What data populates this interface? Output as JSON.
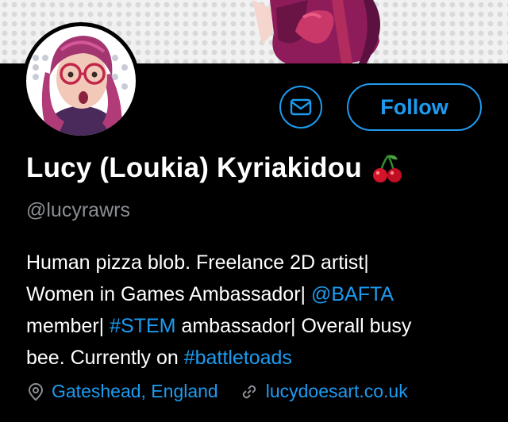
{
  "profile": {
    "display_name": "Lucy (Loukia) Kyriakidou",
    "handle": "@lucyrawrs",
    "name_emoji_icon": "cherries-icon",
    "bio": {
      "line1": "Human pizza blob. Freelance 2D artist|",
      "line2_text": "Women in Games Ambassador| ",
      "line2_link": "@BAFTA",
      "line3_text_a": "member| ",
      "line3_link": "#STEM",
      "line3_text_b": " ambassador| Overall busy",
      "line4_text": "bee. Currently on ",
      "line4_link": "#battletoads"
    },
    "location": "Gateshead, England",
    "website": "lucydoesart.co.uk"
  },
  "actions": {
    "message_icon": "envelope-icon",
    "follow_label": "Follow"
  },
  "colors": {
    "background": "#000000",
    "accent": "#1d9bf0",
    "secondary_text": "#8b8f94"
  }
}
